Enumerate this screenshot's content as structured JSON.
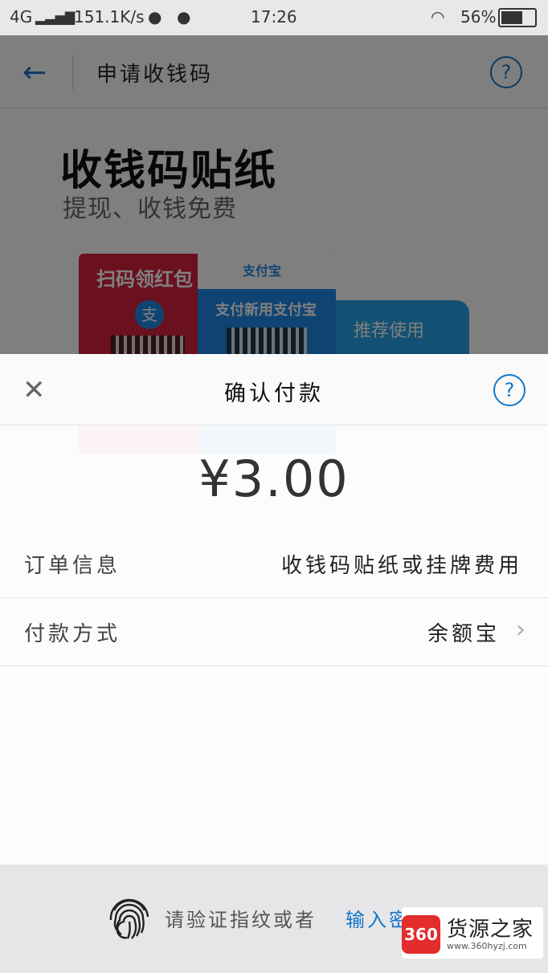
{
  "status_bar": {
    "network": "4G",
    "speed": "151.1K/s",
    "time": "17:26",
    "battery": "56%"
  },
  "background_page": {
    "title": "申请收钱码",
    "hero_title": "收钱码贴纸",
    "hero_subtitle": "提现、收钱免费",
    "card_red_label": "扫码领红包",
    "card_blue_label": "支付新用支付宝",
    "alipay_logo": "支付宝",
    "recommend_label": "推荐使用"
  },
  "sheet": {
    "title": "确认付款",
    "amount": "¥3.00",
    "rows": [
      {
        "label": "订单信息",
        "value": "收钱码贴纸或挂牌费用"
      },
      {
        "label": "付款方式",
        "value": "余额宝"
      }
    ]
  },
  "bottom": {
    "fingerprint_text": "请验证指纹或者",
    "password_link": "输入密码"
  },
  "watermark": {
    "badge": "360",
    "title": "货源之家",
    "url": "www.360hyzj.com"
  },
  "colors": {
    "accent": "#1677c8",
    "red": "#d5213d",
    "blue": "#1e88e5"
  }
}
